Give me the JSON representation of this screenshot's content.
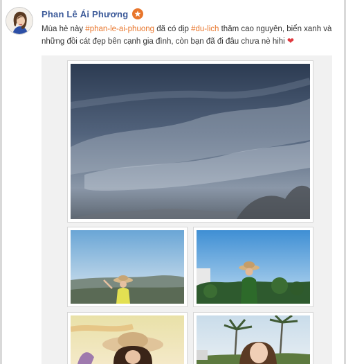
{
  "post": {
    "author": "Phan Lê Ái Phương",
    "text_1": "Mùa hè này ",
    "hashtag_1": "#phan-le-ai-phuong",
    "text_2": " đã có dịp ",
    "hashtag_2": "#du-lich",
    "text_3": " thăm cao nguyên, biển xanh và những đồi cát đẹp bên cạnh gia đình, còn bạn đã đi đâu chưa nè hihi ",
    "heart": "❤"
  },
  "icons": {
    "verified": "verified-badge-icon",
    "heart": "heart-icon"
  },
  "colors": {
    "author_name": "#3c5a99",
    "hashtag": "#e8762c",
    "badge": "#e8762c",
    "heart": "#e0383e"
  },
  "gallery": {
    "photos": [
      {
        "name": "cloudy-sky-photo"
      },
      {
        "name": "mountain-hat-photo"
      },
      {
        "name": "forest-hat-photo"
      },
      {
        "name": "desert-hat-photo"
      },
      {
        "name": "palm-trees-photo"
      }
    ]
  }
}
